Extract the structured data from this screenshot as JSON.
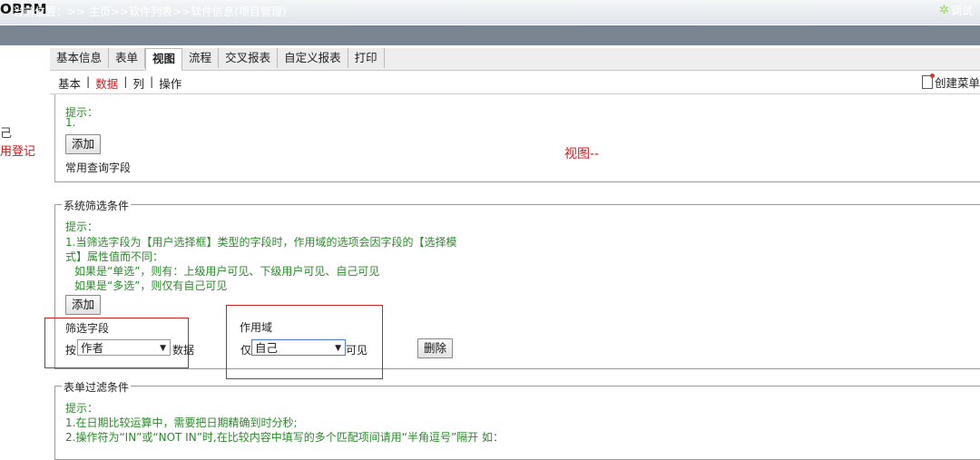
{
  "app": {
    "logo": "OBPM"
  },
  "breadcrumb": {
    "text": "当前位置：>> 主页>>软件列表>>软件信息(项目管理)",
    "debug_label": "调试",
    "debug_icon": "gear-icon"
  },
  "left_sidebar": {
    "item1": "己",
    "item2": "用登记"
  },
  "tabs": [
    {
      "label": "基本信息"
    },
    {
      "label": "表单"
    },
    {
      "label": "视图"
    },
    {
      "label": "流程"
    },
    {
      "label": "交叉报表"
    },
    {
      "label": "自定义报表"
    },
    {
      "label": "打印"
    }
  ],
  "subtabs": [
    {
      "label": "基本"
    },
    {
      "label": "数据"
    },
    {
      "label": "列"
    },
    {
      "label": "操作"
    }
  ],
  "create_menu": {
    "label": "创建菜单"
  },
  "query_section": {
    "hint_title": "提示：",
    "hint_line1": "1.",
    "add_label": "添加",
    "view_title": "视图--",
    "section_label": "常用查询字段"
  },
  "system_filter": {
    "legend": "系统筛选条件",
    "hint_title": "提示：",
    "hint_line1": "1.当筛选字段为【用户选择框】类型的字段时，作用域的选项会因字段的【选择模",
    "hint_line2": "式】属性值而不同：",
    "hint_line3": "如果是“单选”，则有：上级用户可见、下级用户可见、自己可见",
    "hint_line4": "如果是“多选”，则仅有自己可见",
    "add_label": "添加",
    "field_label": "筛选字段",
    "by_prefix": "按",
    "field_value": "作者",
    "data_suffix": "数据",
    "scope_label": "作用域",
    "only_prefix": "仅",
    "scope_value": "自己",
    "visible_suffix": "可见",
    "delete_label": "删除"
  },
  "form_filter": {
    "legend": "表单过滤条件",
    "hint_title": "提示：",
    "hint_line1": "1.在日期比较运算中，需要把日期精确到时分秒;",
    "hint_line2": "2.操作符为“IN”或“NOT IN”时,在比较内容中填写的多个匹配项间请用“半角逗号”隔开 如："
  }
}
